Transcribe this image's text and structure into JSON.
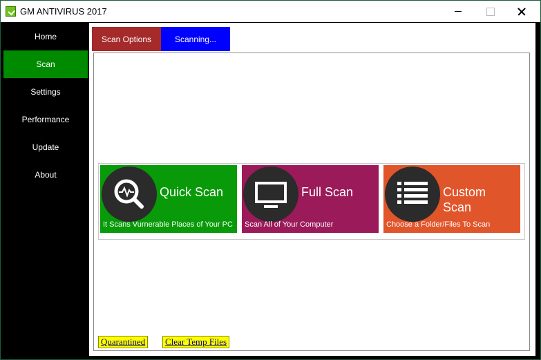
{
  "window": {
    "title": "GM ANTIVIRUS 2017"
  },
  "sidebar": {
    "items": [
      {
        "label": "Home",
        "active": false
      },
      {
        "label": "Scan",
        "active": true
      },
      {
        "label": "Settings",
        "active": false
      },
      {
        "label": "Performance",
        "active": false
      },
      {
        "label": "Update",
        "active": false
      },
      {
        "label": "About",
        "active": false
      }
    ]
  },
  "tabs": [
    {
      "label": "Scan Options",
      "color": "#a52a2a"
    },
    {
      "label": "Scanning...",
      "color": "#0000ff"
    }
  ],
  "scan_cards": [
    {
      "title": "Quick Scan",
      "description": "It Scans Vurnerable Places of Your PC",
      "icon": "magnifier-pulse-icon",
      "color": "#089a08"
    },
    {
      "title": "Full Scan",
      "description": "Scan All of Your Computer",
      "icon": "monitor-icon",
      "color": "#9b1a5a"
    },
    {
      "title": "Custom Scan",
      "description": "Choose a Folder/Files To Scan",
      "icon": "list-icon",
      "color": "#e1552b"
    }
  ],
  "footer_links": [
    {
      "label": "Quarantined"
    },
    {
      "label": "Clear Temp Files"
    }
  ],
  "colors": {
    "sidebar_active": "#008a00",
    "link_background": "#ffff00"
  }
}
